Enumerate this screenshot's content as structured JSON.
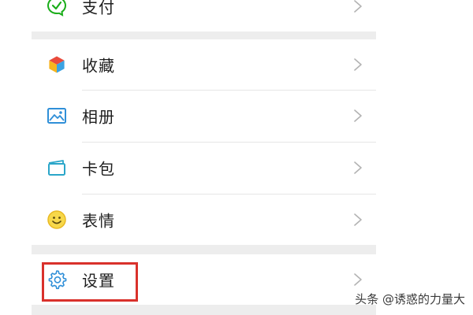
{
  "menu": {
    "items": [
      {
        "label": "支付",
        "icon": "wechat-pay-icon"
      },
      {
        "label": "收藏",
        "icon": "favorites-cube-icon"
      },
      {
        "label": "相册",
        "icon": "photo-album-icon"
      },
      {
        "label": "卡包",
        "icon": "card-wallet-icon"
      },
      {
        "label": "表情",
        "icon": "smiley-sticker-icon"
      },
      {
        "label": "设置",
        "icon": "gear-icon",
        "highlighted": true
      }
    ]
  },
  "watermark": "头条 @诱惑的力量大",
  "colors": {
    "highlight": "#d9312b",
    "separator": "#ededed",
    "pay_green": "#1aad19"
  }
}
